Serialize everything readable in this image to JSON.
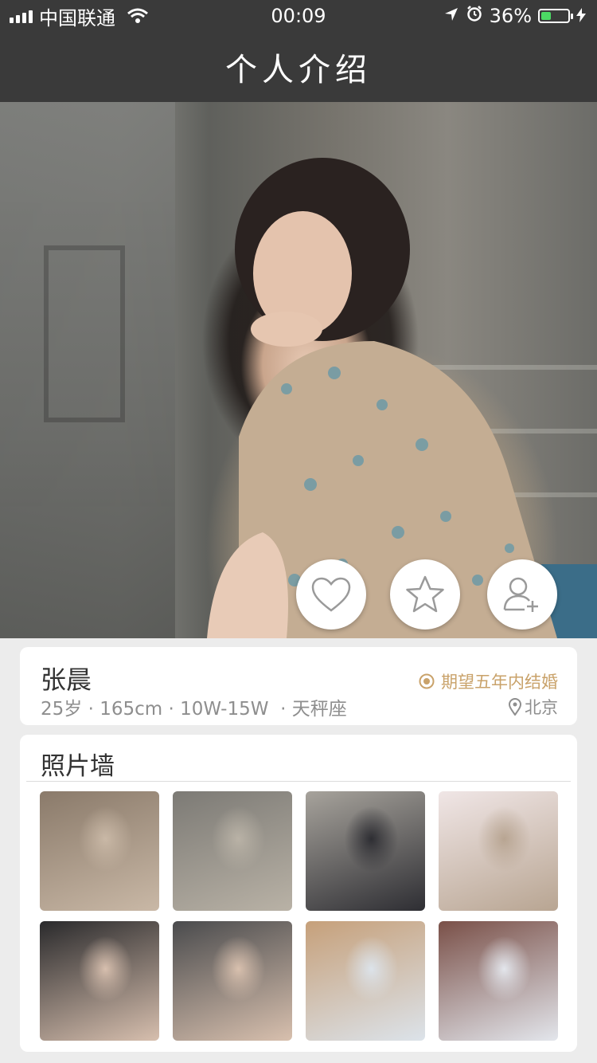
{
  "status_bar": {
    "carrier": "中国联通",
    "time": "00:09",
    "battery_percent": "36%",
    "battery_level": 0.36
  },
  "nav": {
    "title": "个人介绍"
  },
  "profile": {
    "name": "张晨",
    "meta": "25岁 · 165cm · 10W-15W  · 天秤座",
    "expectation": "期望五年内结婚",
    "location": "北京",
    "actions": [
      {
        "icon": "heart-icon"
      },
      {
        "icon": "star-icon"
      },
      {
        "icon": "add-friend-icon"
      }
    ]
  },
  "photo_wall": {
    "title": "照片墙",
    "photos": [
      {
        "colors": [
          "#8a7a6a",
          "#c9b8a6"
        ]
      },
      {
        "colors": [
          "#7c7a75",
          "#b9b2a6"
        ]
      },
      {
        "colors": [
          "#a7a39c",
          "#2e2e33"
        ]
      },
      {
        "colors": [
          "#f0e6e6",
          "#b8a592"
        ]
      },
      {
        "colors": [
          "#2a2a2c",
          "#d7bfae"
        ]
      },
      {
        "colors": [
          "#4a4b4d",
          "#d8c0ae"
        ]
      },
      {
        "colors": [
          "#c6a07a",
          "#dce3ea"
        ]
      },
      {
        "colors": [
          "#7a5048",
          "#e3e6ec"
        ]
      }
    ]
  },
  "colors": {
    "bar": "#3a3a3a",
    "accent_gold": "#c9a26a",
    "battery_green": "#4cd964"
  }
}
